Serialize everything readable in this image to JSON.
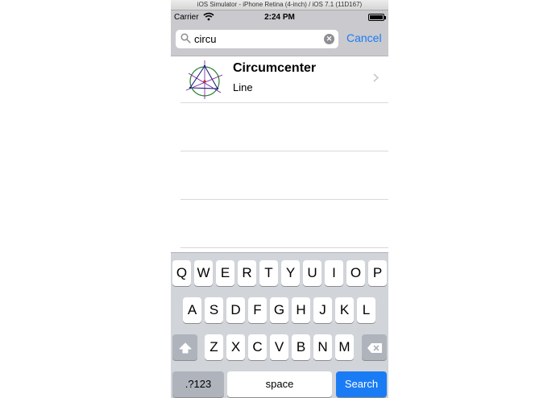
{
  "window": {
    "title": "iOS Simulator - iPhone Retina (4-inch) / iOS 7.1 (11D167)"
  },
  "status_bar": {
    "carrier": "Carrier",
    "time": "2:24 PM"
  },
  "search": {
    "value": "circu",
    "cancel_label": "Cancel"
  },
  "results": [
    {
      "title": "Circumcenter",
      "subtitle": "Line"
    }
  ],
  "keyboard": {
    "row1": [
      "Q",
      "W",
      "E",
      "R",
      "T",
      "Y",
      "U",
      "I",
      "O",
      "P"
    ],
    "row2": [
      "A",
      "S",
      "D",
      "F",
      "G",
      "H",
      "J",
      "K",
      "L"
    ],
    "row3": [
      "Z",
      "X",
      "C",
      "V",
      "B",
      "N",
      "M"
    ],
    "numbers_label": ".?123",
    "space_label": "space",
    "search_label": "Search"
  },
  "colors": {
    "accent": "#1a7cf4",
    "bar_background": "#c9c9ce",
    "keyboard_background": "#d1d4d9"
  }
}
